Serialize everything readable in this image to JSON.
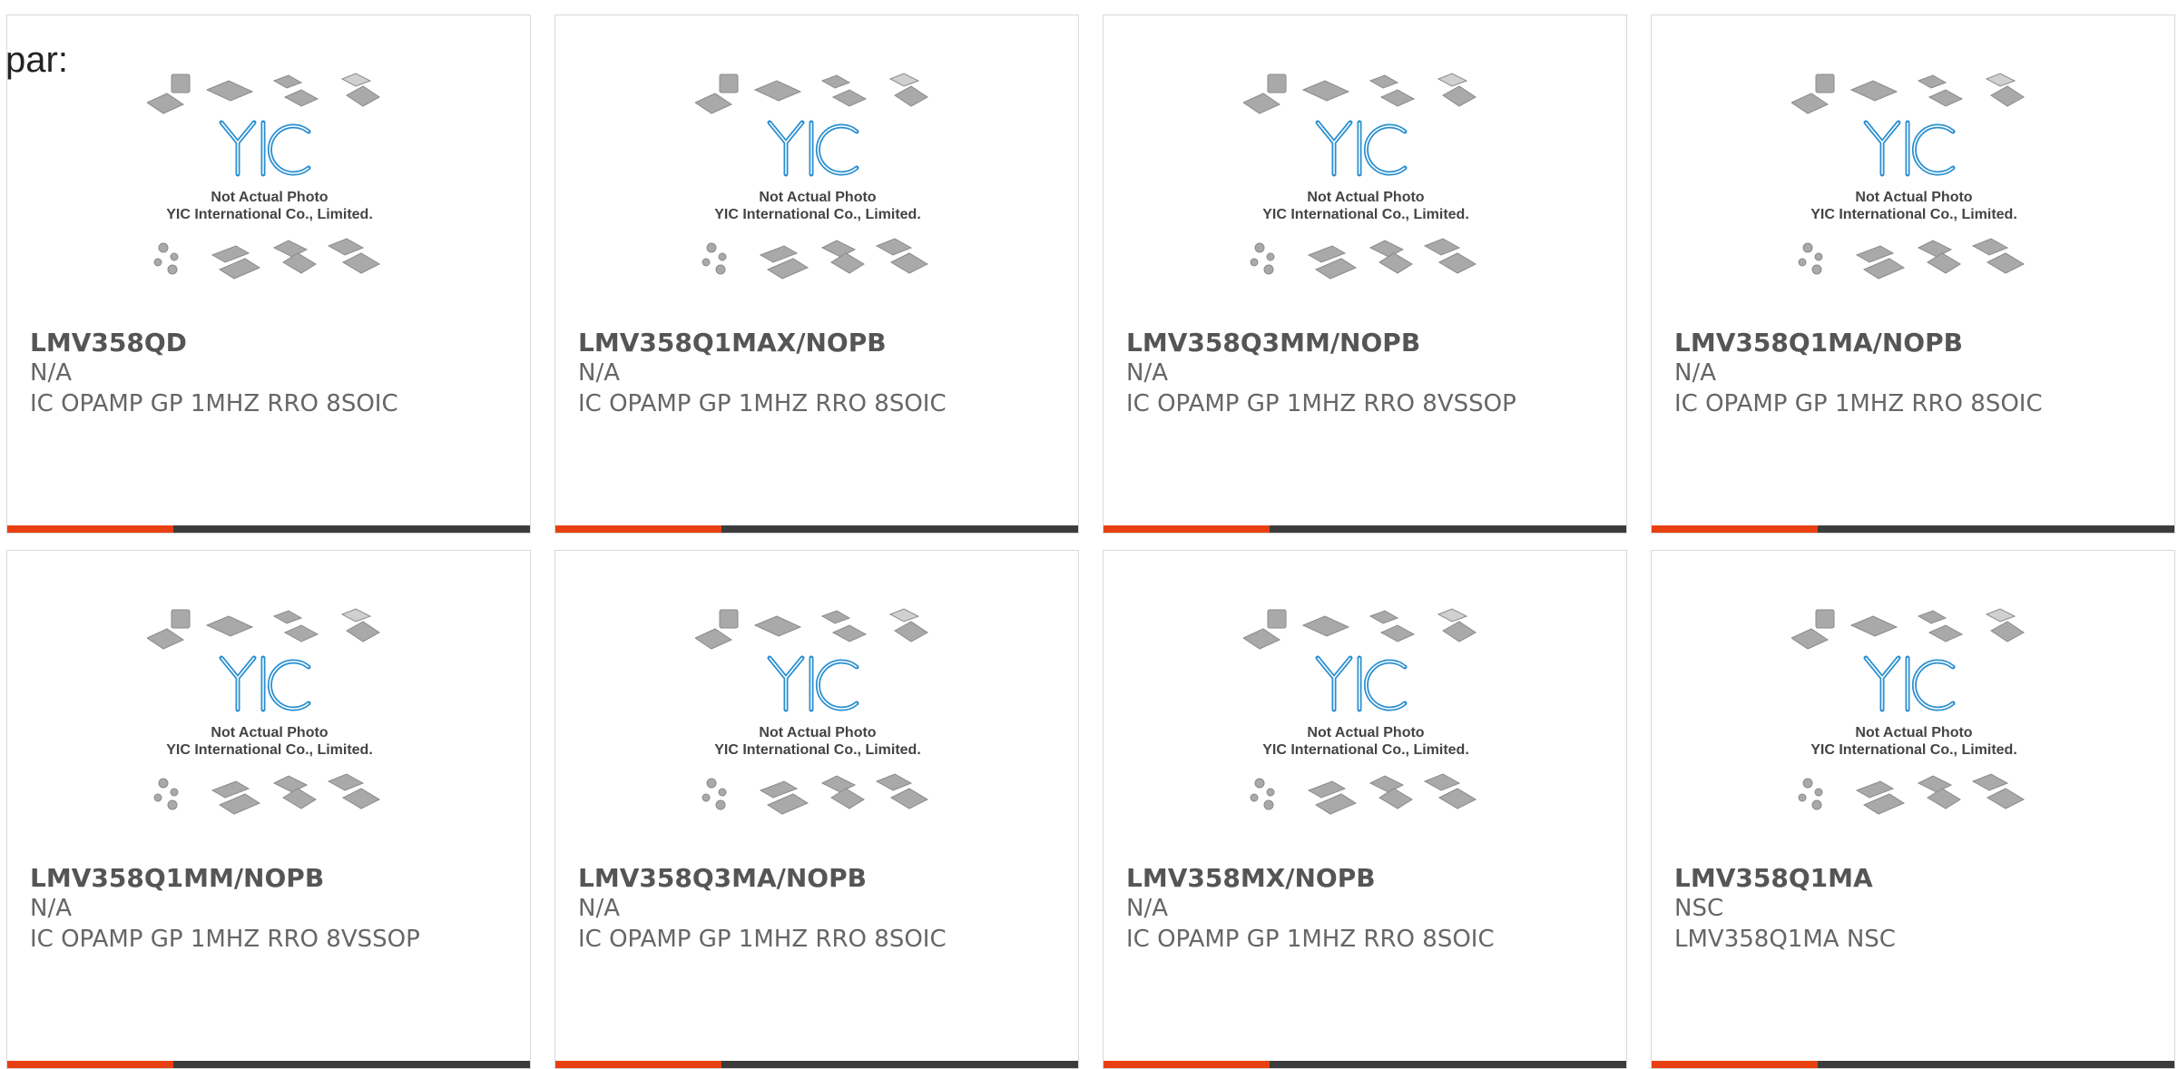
{
  "intro_label": "par:",
  "placeholder_text": {
    "line1": "Not Actual Photo",
    "line2": "YIC International Co., Limited.",
    "logo": "YIC"
  },
  "colors": {
    "accent": "#e84012",
    "bar": "#3c3c3c",
    "logo_blue": "#2a8fd0"
  },
  "products": [
    {
      "part": "LMV358QD",
      "manufacturer": "N/A",
      "description": "IC OPAMP GP 1MHZ RRO 8SOIC"
    },
    {
      "part": "LMV358Q1MAX/NOPB",
      "manufacturer": "N/A",
      "description": "IC OPAMP GP 1MHZ RRO 8SOIC"
    },
    {
      "part": "LMV358Q3MM/NOPB",
      "manufacturer": "N/A",
      "description": "IC OPAMP GP 1MHZ RRO 8VSSOP"
    },
    {
      "part": "LMV358Q1MA/NOPB",
      "manufacturer": "N/A",
      "description": "IC OPAMP GP 1MHZ RRO 8SOIC"
    },
    {
      "part": "LMV358Q1MM/NOPB",
      "manufacturer": "N/A",
      "description": "IC OPAMP GP 1MHZ RRO 8VSSOP"
    },
    {
      "part": "LMV358Q3MA/NOPB",
      "manufacturer": "N/A",
      "description": "IC OPAMP GP 1MHZ RRO 8SOIC"
    },
    {
      "part": "LMV358MX/NOPB",
      "manufacturer": "N/A",
      "description": "IC OPAMP GP 1MHZ RRO 8SOIC"
    },
    {
      "part": "LMV358Q1MA",
      "manufacturer": "NSC",
      "description": "LMV358Q1MA NSC"
    }
  ]
}
